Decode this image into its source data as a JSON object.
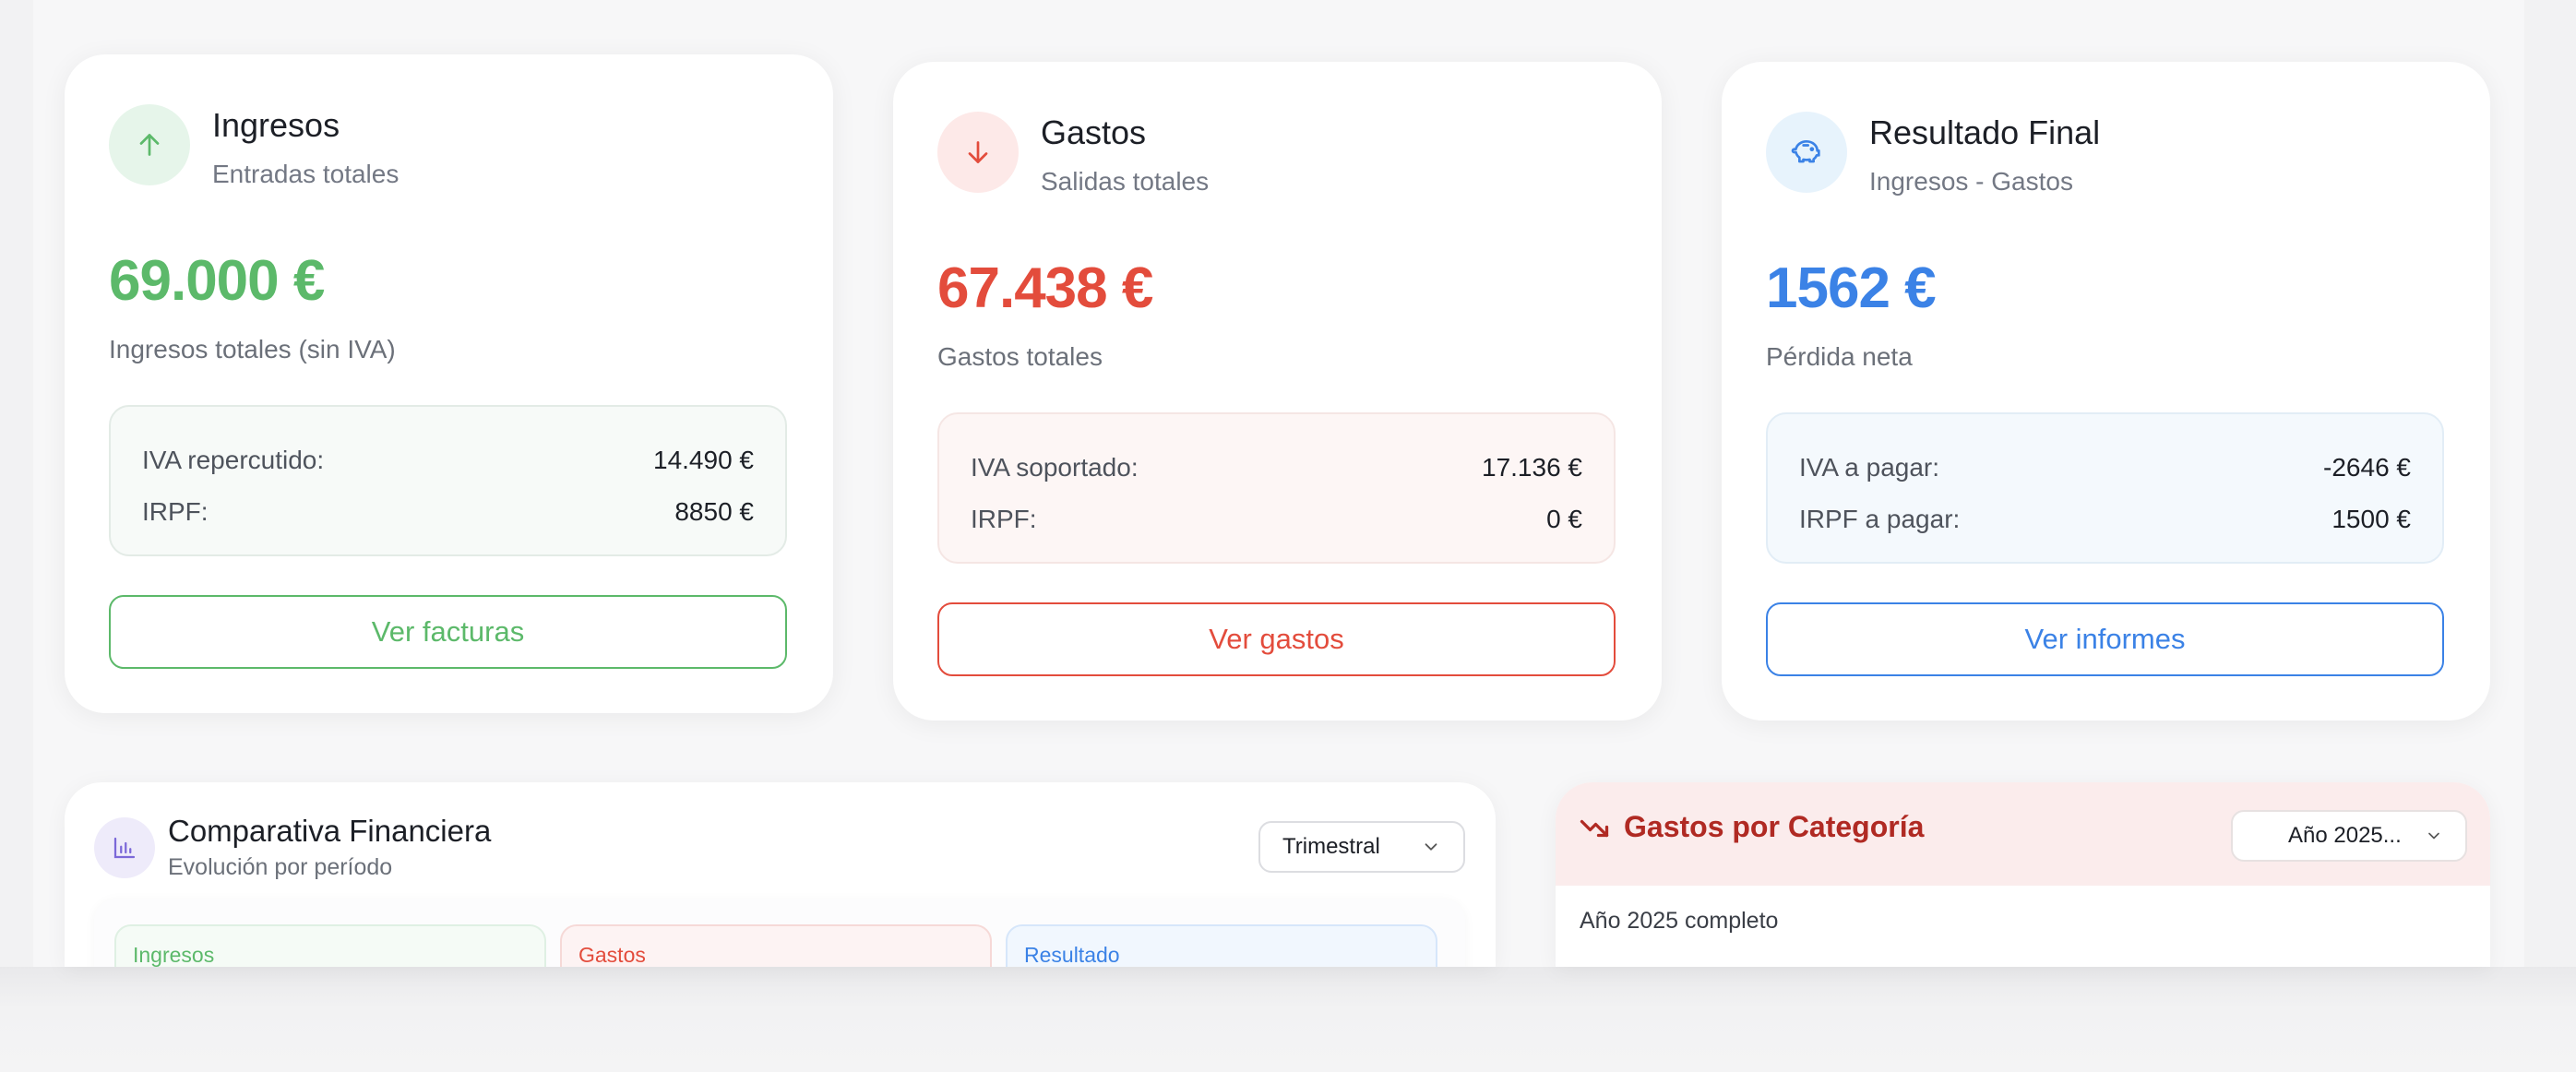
{
  "cards": {
    "income": {
      "title": "Ingresos",
      "subtitle": "Entradas totales",
      "amount": "69.000 €",
      "amount_label": "Ingresos totales (sin IVA)",
      "rows": [
        {
          "label": "IVA repercutido:",
          "value": "14.490 €"
        },
        {
          "label": "IRPF:",
          "value": "8850 €"
        }
      ],
      "button": "Ver facturas",
      "icon": "arrow-up-icon",
      "color": "#5cb96a"
    },
    "expenses": {
      "title": "Gastos",
      "subtitle": "Salidas totales",
      "amount": "67.438 €",
      "amount_label": "Gastos totales",
      "rows": [
        {
          "label": "IVA soportado:",
          "value": "17.136 €"
        },
        {
          "label": "IRPF:",
          "value": "0 €"
        }
      ],
      "button": "Ver gastos",
      "icon": "arrow-down-icon",
      "color": "#e34c3c"
    },
    "result": {
      "title": "Resultado Final",
      "subtitle": "Ingresos - Gastos",
      "amount": "1562 €",
      "amount_label": "Pérdida neta",
      "rows": [
        {
          "label": "IVA a pagar:",
          "value": "-2646 €"
        },
        {
          "label": "IRPF a pagar:",
          "value": "1500 €"
        }
      ],
      "button": "Ver informes",
      "icon": "piggy-bank-icon",
      "color": "#3b82e6"
    }
  },
  "comparison": {
    "title": "Comparativa Financiera",
    "subtitle": "Evolución por período",
    "period_select": "Trimestral",
    "mini_cards": [
      "Ingresos",
      "Gastos",
      "Resultado"
    ],
    "icon": "bar-chart-icon"
  },
  "categories": {
    "title": "Gastos por Categoría",
    "year_select": "Año 2025...",
    "period_label": "Año 2025 completo",
    "icon": "trending-down-icon",
    "accent": "#b02a23"
  }
}
